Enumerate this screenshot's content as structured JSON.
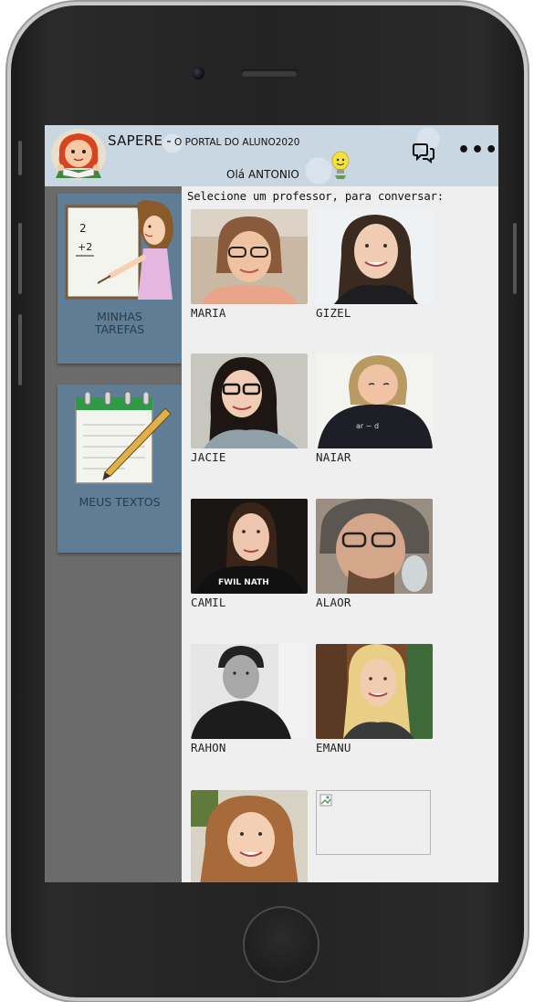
{
  "header": {
    "brand": "SAPERE",
    "separator": "-",
    "subtitle": "O PORTAL DO ALUNO2020",
    "greeting": "Olá ANTONIO",
    "icons": [
      "chat-icon",
      "more-options-icon"
    ],
    "more_label": "•••"
  },
  "sidebar": {
    "items": [
      {
        "label_line1": "MINHAS",
        "label_line2": "TAREFAS",
        "icon": "teacher-board-icon"
      },
      {
        "label": "MEUS TEXTOS",
        "icon": "notepad-pencil-icon"
      }
    ]
  },
  "main": {
    "prompt": "Selecione um professor, para conversar:",
    "teachers": [
      {
        "name": "MARIA"
      },
      {
        "name": "GIZEL"
      },
      {
        "name": "JACIE"
      },
      {
        "name": "NAIAR"
      },
      {
        "name": "CAMIL"
      },
      {
        "name": "ALAOR"
      },
      {
        "name": "RAHON"
      },
      {
        "name": "EMANU"
      },
      {
        "name": ""
      },
      {
        "name": ""
      }
    ]
  },
  "colors": {
    "header_bg": "#c9d7e2",
    "sidebar_bg": "#6b6b6b",
    "menu_card_bg": "#5f7d94",
    "content_bg": "#efefef"
  }
}
